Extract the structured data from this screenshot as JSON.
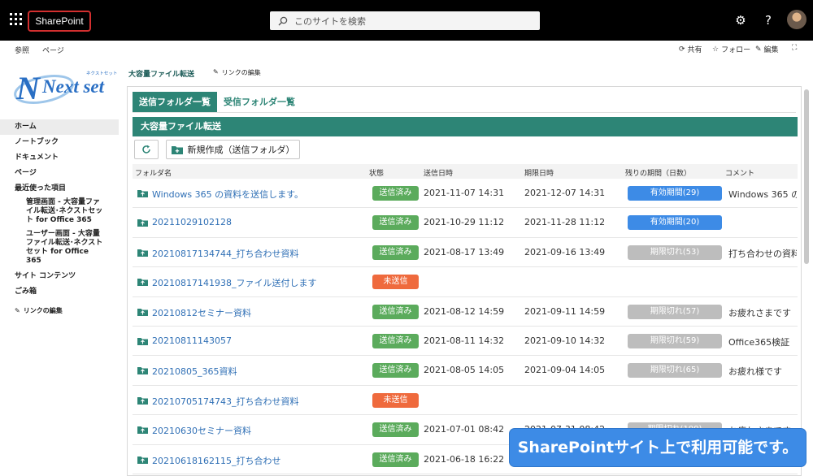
{
  "suite": {
    "brand": "SharePoint",
    "search_placeholder": "このサイトを検索"
  },
  "cmdbar": {
    "left": [
      "参照",
      "ページ"
    ],
    "share": "共有",
    "follow": "フォロー",
    "edit": "編集"
  },
  "logo": {
    "main": "Next set",
    "sub": "ネクストセット"
  },
  "nav": {
    "home": "ホーム",
    "notebook": "ノートブック",
    "documents": "ドキュメント",
    "pages": "ページ",
    "recent": "最近使った項目",
    "recent_1": "管理画面 - 大容量ファイル転送･ネクストセット for Office 365",
    "recent_2": "ユーザー画面 - 大容量ファイル転送･ネクストセット for Office 365",
    "site_contents": "サイト コンテンツ",
    "recycle": "ごみ箱",
    "edit_links": "リンクの編集"
  },
  "header": {
    "title": "大容量ファイル転送",
    "edit_links": "リンクの編集"
  },
  "tabs": [
    "送信フォルダ一覧",
    "受信フォルダ一覧"
  ],
  "banner": "大容量ファイル転送",
  "new_button": "新規作成（送信フォルダ）",
  "columns": [
    "フォルダ名",
    "状態",
    "送信日時",
    "期限日時",
    "残りの期間（日数）",
    "コメント"
  ],
  "colors": {
    "sent": "#5bab5c",
    "unsent": "#ef6a3d",
    "valid": "#3d8be6",
    "expired": "#bdbdbd",
    "accent": "#2d8576"
  },
  "rows": [
    {
      "name": "Windows 365 の資料を送信します。",
      "status": "送信済み",
      "status_type": "sent",
      "sent": "2021-11-07 14:31",
      "expire": "2021-12-07 14:31",
      "remain": "有効期間(29)",
      "remain_type": "valid",
      "comment": "Windows 365 の"
    },
    {
      "name": "20211029102128",
      "status": "送信済み",
      "status_type": "sent",
      "sent": "2021-10-29 11:12",
      "expire": "2021-11-28 11:12",
      "remain": "有効期間(20)",
      "remain_type": "valid",
      "comment": ""
    },
    {
      "name": "20210817134744_打ち合わせ資料",
      "status": "送信済み",
      "status_type": "sent",
      "sent": "2021-08-17 13:49",
      "expire": "2021-09-16 13:49",
      "remain": "期限切れ(53)",
      "remain_type": "expired",
      "comment": "打ち合わせの資料"
    },
    {
      "name": "20210817141938_ファイル送付します",
      "status": "未送信",
      "status_type": "unsent",
      "sent": "",
      "expire": "",
      "remain": "",
      "remain_type": "",
      "comment": ""
    },
    {
      "name": "20210812セミナー資料",
      "status": "送信済み",
      "status_type": "sent",
      "sent": "2021-08-12 14:59",
      "expire": "2021-09-11 14:59",
      "remain": "期限切れ(57)",
      "remain_type": "expired",
      "comment": "お疲れさまです"
    },
    {
      "name": "20210811143057",
      "status": "送信済み",
      "status_type": "sent",
      "sent": "2021-08-11 14:32",
      "expire": "2021-09-10 14:32",
      "remain": "期限切れ(59)",
      "remain_type": "expired",
      "comment": "Office365検証"
    },
    {
      "name": "20210805_365資料",
      "status": "送信済み",
      "status_type": "sent",
      "sent": "2021-08-05 14:05",
      "expire": "2021-09-04 14:05",
      "remain": "期限切れ(65)",
      "remain_type": "expired",
      "comment": "お疲れ様です"
    },
    {
      "name": "20210705174743_打ち合わせ資料",
      "status": "未送信",
      "status_type": "unsent",
      "sent": "",
      "expire": "",
      "remain": "",
      "remain_type": "",
      "comment": ""
    },
    {
      "name": "20210630セミナー資料",
      "status": "送信済み",
      "status_type": "sent",
      "sent": "2021-07-01 08:42",
      "expire": "2021-07-31 08:42",
      "remain": "期限切れ(100)",
      "remain_type": "expired",
      "comment": "お疲れさまです"
    },
    {
      "name": "20210618162115_打ち合わせ",
      "status": "送信済み",
      "status_type": "sent",
      "sent": "2021-06-18 16:22",
      "expire": "",
      "remain": "",
      "remain_type": "",
      "comment": ""
    }
  ],
  "callout": "SharePointサイト上で利用可能です。"
}
